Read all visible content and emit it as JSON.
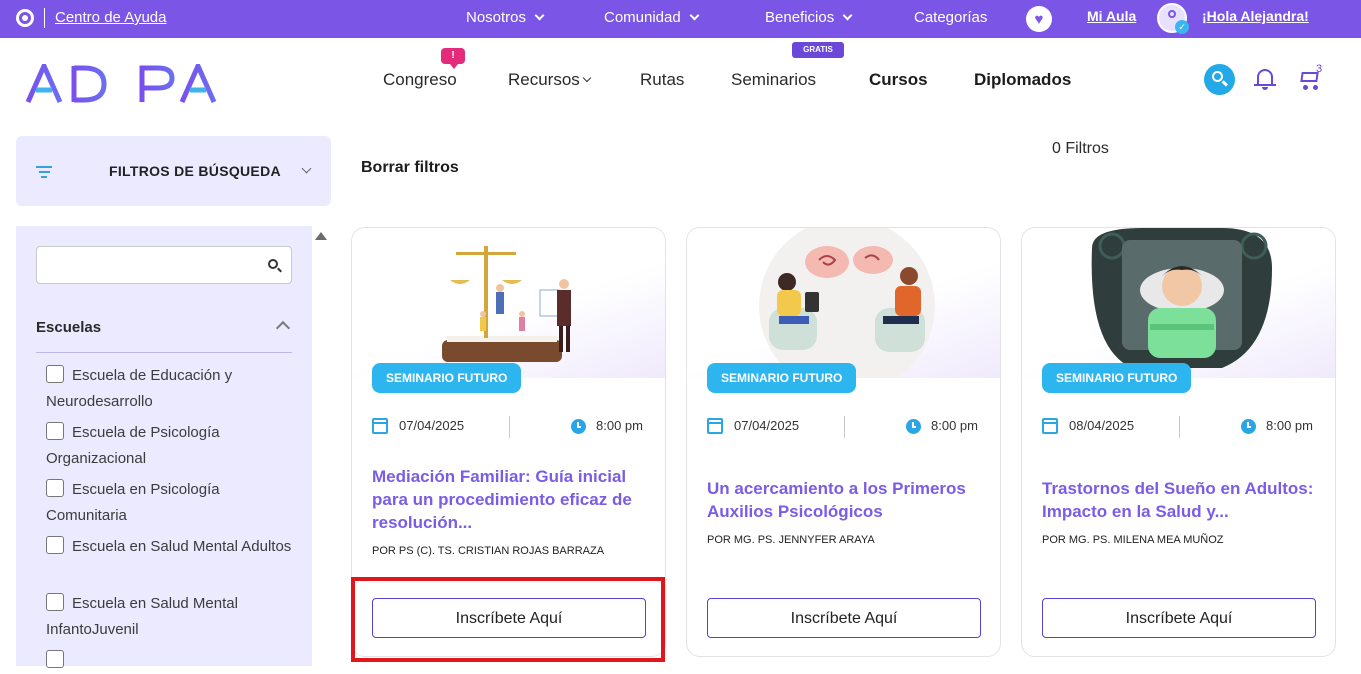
{
  "topbar": {
    "help_label": "Centro de Ayuda",
    "nav": [
      "Nosotros",
      "Comunidad",
      "Beneficios",
      "Categorías"
    ],
    "mi_aula": "Mi Aula",
    "greeting": "¡Hola Alejandra!",
    "icons": [
      "whatsapp-icon",
      "heart-icon",
      "user-avatar-icon"
    ]
  },
  "header": {
    "logo": "ADIPA",
    "nav": [
      "Congreso",
      "Recursos",
      "Rutas",
      "Seminarios",
      "Cursos",
      "Diplomados"
    ],
    "congreso_badge": "!",
    "seminarios_badge": "GRATIS",
    "cart_count": "3",
    "icons": [
      "search-icon",
      "bell-icon",
      "cart-icon"
    ],
    "accent": "#7b55e6"
  },
  "filters": {
    "title": "FILTROS DE BÚSQUEDA",
    "clear_label": "Borrar filtros",
    "count_label": "0 Filtros",
    "search_placeholder": "",
    "schools_title": "Escuelas",
    "schools": [
      "Escuela de Educación y Neurodesarrollo",
      "Escuela de Psicología Organizacional",
      "Escuela en Psicología Comunitaria",
      "Escuela en Salud Mental Adultos",
      "Escuela en Salud Mental InfantoJuvenil"
    ]
  },
  "cards": [
    {
      "tag": "SEMINARIO FUTURO",
      "date": "07/04/2025",
      "time": "8:00 pm",
      "title": "Mediación Familiar: Guía inicial para un procedimiento eficaz de resolución...",
      "author": "POR PS (C). TS. CRISTIAN ROJAS BARRAZA",
      "button": "Inscríbete Aquí"
    },
    {
      "tag": "SEMINARIO FUTURO",
      "date": "07/04/2025",
      "time": "8:00 pm",
      "title": "Un acercamiento a los Primeros Auxilios Psicológicos",
      "author": "POR MG. PS. JENNYFER ARAYA",
      "button": "Inscríbete Aquí"
    },
    {
      "tag": "SEMINARIO FUTURO",
      "date": "08/04/2025",
      "time": "8:00 pm",
      "title": "Trastornos del Sueño en Adultos: Impacto en la Salud y...",
      "author": "POR MG. PS. MILENA MEA MUÑOZ",
      "button": "Inscríbete Aquí"
    }
  ]
}
